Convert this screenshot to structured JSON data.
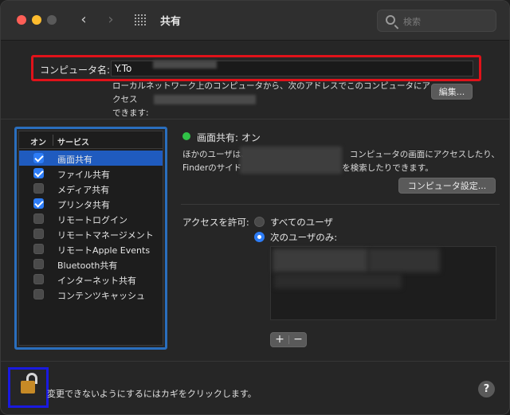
{
  "window": {
    "title": "共有"
  },
  "search": {
    "placeholder": "検索"
  },
  "computer_name": {
    "label": "コンピュータ名:",
    "value": "Y.To"
  },
  "address": {
    "line1": "ローカルネットワーク上のコンピュータから、次のアドレスでこのコンピュータにアクセス",
    "line2": "できます:",
    "edit_label": "編集..."
  },
  "services": {
    "header_on": "オン",
    "header_service": "サービス",
    "items": [
      {
        "label": "画面共有",
        "checked": true,
        "selected": true
      },
      {
        "label": "ファイル共有",
        "checked": true,
        "selected": false
      },
      {
        "label": "メディア共有",
        "checked": false,
        "selected": false
      },
      {
        "label": "プリンタ共有",
        "checked": true,
        "selected": false
      },
      {
        "label": "リモートログイン",
        "checked": false,
        "selected": false
      },
      {
        "label": "リモートマネージメント",
        "checked": false,
        "selected": false
      },
      {
        "label": "リモートApple Events",
        "checked": false,
        "selected": false
      },
      {
        "label": "Bluetooth共有",
        "checked": false,
        "selected": false
      },
      {
        "label": "インターネット共有",
        "checked": false,
        "selected": false
      },
      {
        "label": "コンテンツキャッシュ",
        "checked": false,
        "selected": false
      }
    ]
  },
  "detail": {
    "status": "画面共有: オン",
    "status_color": "#30c247",
    "desc_line1": "ほかのユーザは、",
    "desc_line1b": "コンピュータの画面にアクセスしたり、",
    "desc_line2": "Finderのサイド",
    "desc_line2b": "を検索したりできます。",
    "computer_settings_label": "コンピュータ設定...",
    "access_label": "アクセスを許可:",
    "option_all": "すべてのユーザ",
    "option_only": "次のユーザのみ:",
    "plus": "+",
    "minus": "−"
  },
  "footer": {
    "lock_text": "変更できないようにするにはカギをクリックします。",
    "help": "?"
  },
  "colors": {
    "accent": "#2d7cf6",
    "name_highlight": "#e0121a",
    "list_highlight": "#2a6ebd",
    "lock_highlight": "#1a1adf"
  }
}
